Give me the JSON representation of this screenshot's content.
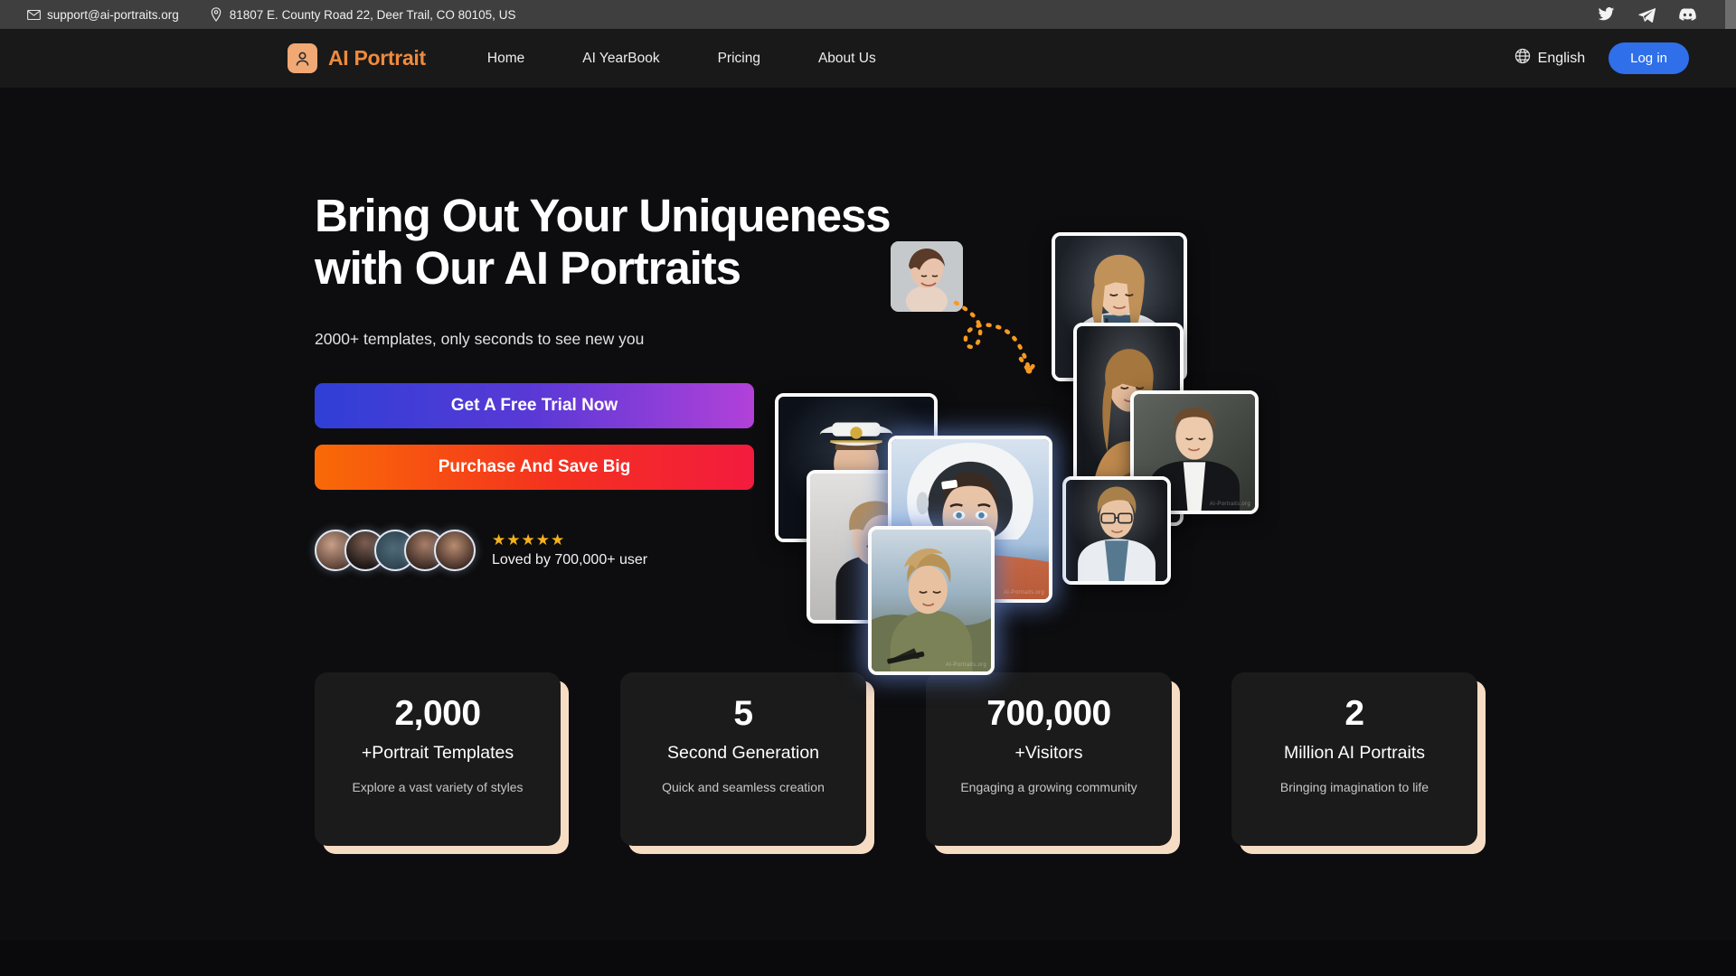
{
  "topbar": {
    "email": "support@ai-portraits.org",
    "email_icon": "envelope-icon",
    "address": "81807 E. County Road 22, Deer Trail, CO 80105, US",
    "address_icon": "location-pin-icon",
    "social": [
      {
        "name": "twitter-icon",
        "label": "Twitter"
      },
      {
        "name": "telegram-icon",
        "label": "Telegram"
      },
      {
        "name": "discord-icon",
        "label": "Discord"
      }
    ]
  },
  "nav": {
    "brand": "AI Portrait",
    "brand_icon": "person-avatar-icon",
    "brand_color": "#f08a3c",
    "links": [
      {
        "label": "Home"
      },
      {
        "label": "AI YearBook"
      },
      {
        "label": "Pricing"
      },
      {
        "label": "About Us"
      }
    ],
    "language": "English",
    "language_icon": "globe-icon",
    "login_label": "Log in",
    "login_color": "#2f6fea"
  },
  "hero": {
    "headline_line1": "Bring Out Your Uniqueness",
    "headline_line2": "with Our AI Portraits",
    "subhead": "2000+ templates, only seconds to see new you",
    "cta_primary": "Get A Free Trial Now",
    "cta_secondary": "Purchase And Save Big",
    "stars": "★★★★★",
    "star_color": "#f5b21b",
    "loved_text": "Loved by 700,000+ user",
    "avatar_count": 5,
    "watermark": "AI-Portraits.org",
    "collage_cards": [
      {
        "name": "source-photo",
        "style": "original headshot"
      },
      {
        "name": "portrait-navy-captain",
        "style": "Navy Captain"
      },
      {
        "name": "portrait-police-officer",
        "style": "Police Officer"
      },
      {
        "name": "portrait-astronaut",
        "style": "Astronaut"
      },
      {
        "name": "portrait-doctor-blonde",
        "style": "Doctor"
      },
      {
        "name": "portrait-casual-guitar",
        "style": "Casual"
      },
      {
        "name": "portrait-business-suit",
        "style": "Business Suit"
      },
      {
        "name": "portrait-doctor-glasses",
        "style": "Doctor with Glasses"
      },
      {
        "name": "portrait-soldier",
        "style": "Soldier"
      }
    ]
  },
  "stats": [
    {
      "number": "2,000",
      "label": "+Portrait Templates",
      "desc": "Explore a vast variety of styles"
    },
    {
      "number": "5",
      "label": "Second Generation",
      "desc": "Quick and seamless creation"
    },
    {
      "number": "700,000",
      "label": "+Visitors",
      "desc": "Engaging a growing community"
    },
    {
      "number": "2",
      "label": "Million AI Portraits",
      "desc": "Bringing imagination to life"
    }
  ],
  "theme": {
    "topbar_bg": "#3f3f3f",
    "nav_bg": "#191919",
    "page_bg": "#0d0d0f",
    "card_bg": "#1b1b1b",
    "card_shadow": "#f7dcc4"
  }
}
